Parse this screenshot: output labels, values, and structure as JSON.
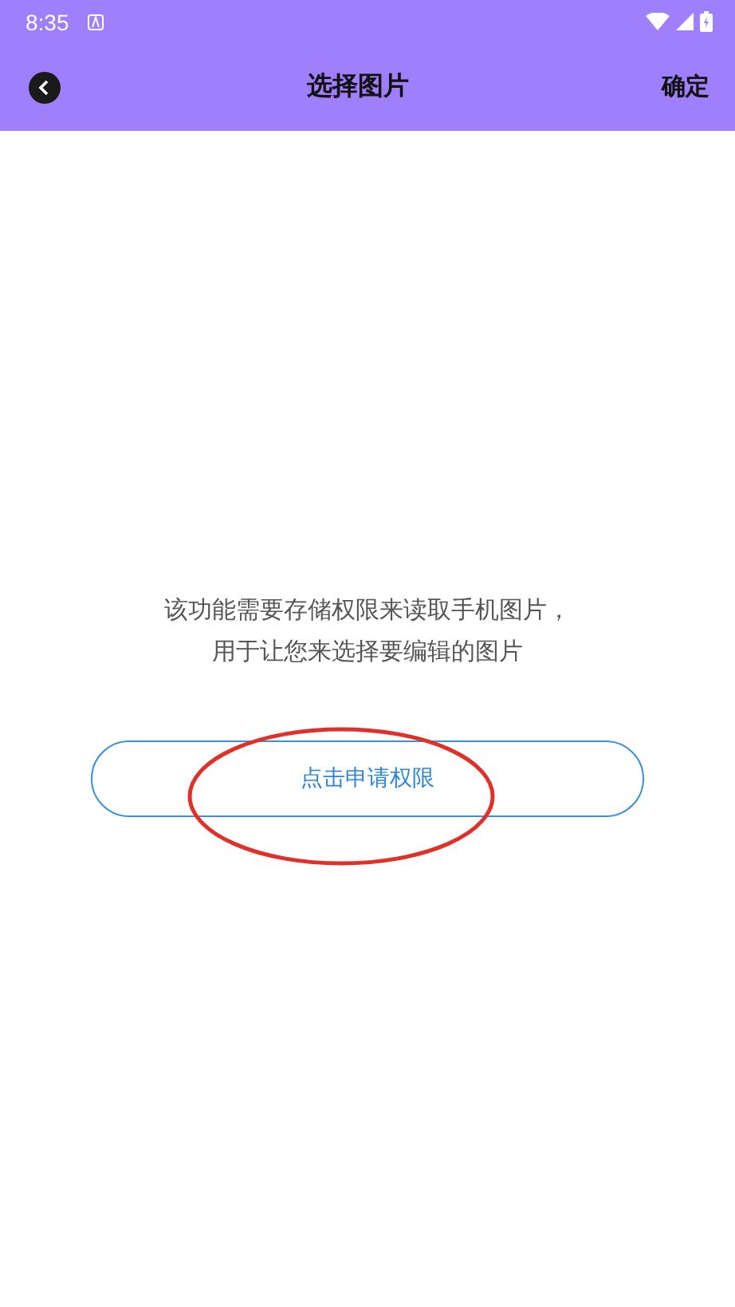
{
  "status_bar": {
    "time": "8:35"
  },
  "toolbar": {
    "title": "选择图片",
    "action": "确定"
  },
  "message": {
    "lines": [
      "该功能需要存储权限来读取手机图片，",
      "用于让您来选择要编辑的图片"
    ]
  },
  "permission_button": {
    "label": "点击申请权限"
  },
  "annotation": {
    "kind": "ellipse",
    "color": "#e0302a"
  }
}
